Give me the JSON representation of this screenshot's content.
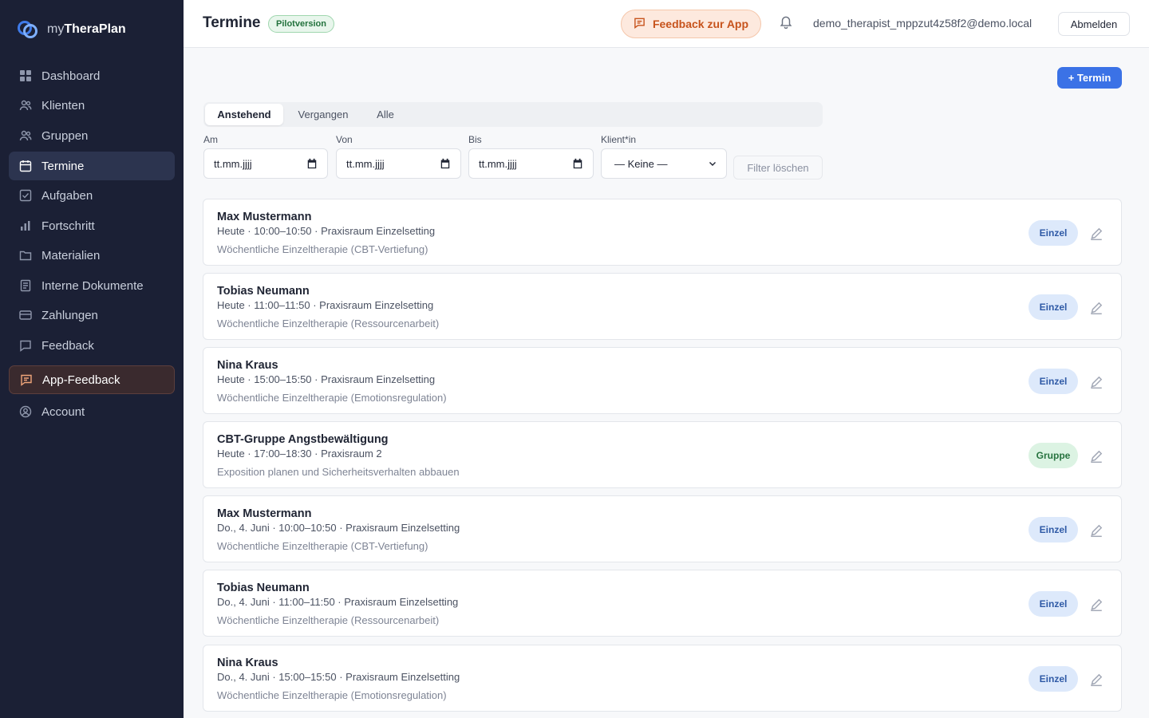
{
  "app": {
    "name_prefix": "my",
    "name_bold": "TheraPlan"
  },
  "sidebar": {
    "items": [
      {
        "label": "Dashboard",
        "icon": "grid-icon"
      },
      {
        "label": "Klienten",
        "icon": "users-icon"
      },
      {
        "label": "Gruppen",
        "icon": "users-icon"
      },
      {
        "label": "Termine",
        "icon": "calendar-icon",
        "active": true
      },
      {
        "label": "Aufgaben",
        "icon": "checkbox-icon"
      },
      {
        "label": "Fortschritt",
        "icon": "bar-chart-icon"
      },
      {
        "label": "Materialien",
        "icon": "folder-icon"
      },
      {
        "label": "Interne Dokumente",
        "icon": "document-icon"
      },
      {
        "label": "Zahlungen",
        "icon": "credit-card-icon"
      },
      {
        "label": "Feedback",
        "icon": "message-icon"
      },
      {
        "label": "App-Feedback",
        "icon": "message-icon",
        "highlight": true
      },
      {
        "label": "Account",
        "icon": "user-circle-icon"
      }
    ]
  },
  "header": {
    "title": "Termine",
    "badge": "Pilotversion",
    "feedback_button": "Feedback zur App",
    "user_email": "demo_therapist_mppzut4z58f2@demo.local",
    "logout": "Abmelden"
  },
  "main": {
    "add_button": "+ Termin",
    "tabs": [
      {
        "label": "Anstehend",
        "active": true
      },
      {
        "label": "Vergangen"
      },
      {
        "label": "Alle"
      }
    ],
    "filters": {
      "am": {
        "label": "Am",
        "placeholder": "tt.mm.jjjj"
      },
      "von": {
        "label": "Von",
        "placeholder": "tt.mm.jjjj"
      },
      "bis": {
        "label": "Bis",
        "placeholder": "tt.mm.jjjj"
      },
      "klient": {
        "label": "Klient*in",
        "value": "— Keine —"
      },
      "clear": "Filter löschen"
    },
    "appointments": [
      {
        "name": "Max Mustermann",
        "meta": "Heute · 10:00–10:50 · Praxisraum Einzelsetting",
        "desc": "Wöchentliche Einzeltherapie (CBT-Vertiefung)",
        "type": "Einzel"
      },
      {
        "name": "Tobias Neumann",
        "meta": "Heute · 11:00–11:50 · Praxisraum Einzelsetting",
        "desc": "Wöchentliche Einzeltherapie (Ressourcenarbeit)",
        "type": "Einzel"
      },
      {
        "name": "Nina Kraus",
        "meta": "Heute · 15:00–15:50 · Praxisraum Einzelsetting",
        "desc": "Wöchentliche Einzeltherapie (Emotionsregulation)",
        "type": "Einzel"
      },
      {
        "name": "CBT-Gruppe Angstbewältigung",
        "meta": "Heute · 17:00–18:30 · Praxisraum 2",
        "desc": "Exposition planen und Sicherheitsverhalten abbauen",
        "type": "Gruppe"
      },
      {
        "name": "Max Mustermann",
        "meta": "Do., 4. Juni · 10:00–10:50 · Praxisraum Einzelsetting",
        "desc": "Wöchentliche Einzeltherapie (CBT-Vertiefung)",
        "type": "Einzel"
      },
      {
        "name": "Tobias Neumann",
        "meta": "Do., 4. Juni · 11:00–11:50 · Praxisraum Einzelsetting",
        "desc": "Wöchentliche Einzeltherapie (Ressourcenarbeit)",
        "type": "Einzel"
      },
      {
        "name": "Nina Kraus",
        "meta": "Do., 4. Juni · 15:00–15:50 · Praxisraum Einzelsetting",
        "desc": "Wöchentliche Einzeltherapie (Emotionsregulation)",
        "type": "Einzel"
      }
    ]
  },
  "colors": {
    "sidebar_bg": "#1b2035",
    "accent": "#3b72e6",
    "feedback_orange": "#c7531c",
    "badge_einzel": "#dde9fb",
    "badge_gruppe": "#dcf3e3"
  }
}
